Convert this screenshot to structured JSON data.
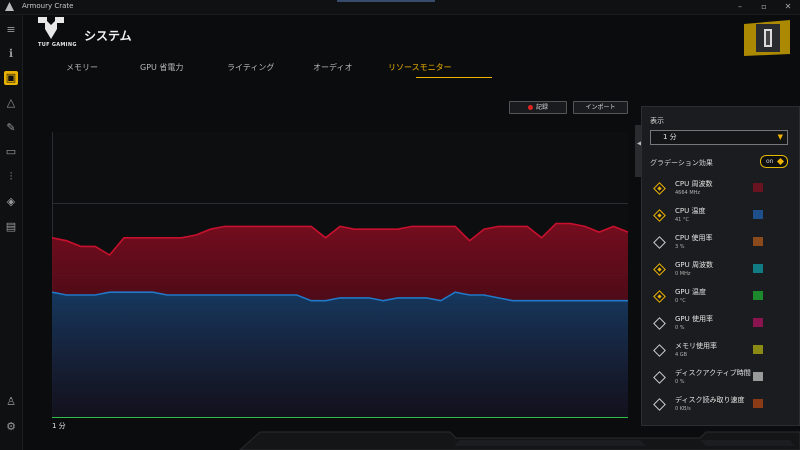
{
  "window": {
    "title": "Armoury Crate"
  },
  "header": {
    "page_title": "システム",
    "logo_text": "TUF GAMING"
  },
  "tabs": [
    {
      "label": "メモリー",
      "active": false
    },
    {
      "label": "GPU 省電力",
      "active": false
    },
    {
      "label": "ライティング",
      "active": false
    },
    {
      "label": "オーディオ",
      "active": false
    },
    {
      "label": "リソースモニター",
      "active": true
    }
  ],
  "toolbar": {
    "record_label": "記録",
    "import_label": "インポート"
  },
  "chart_data": {
    "type": "area",
    "xlabel": "1 分",
    "series": [
      {
        "name": "CPU 周波数",
        "color": "#c8102e",
        "values": [
          63,
          62,
          60,
          60,
          57,
          63,
          63,
          63,
          63,
          63,
          64,
          66,
          67,
          67,
          67,
          67,
          67,
          67,
          67,
          63,
          67,
          66,
          66,
          66,
          66,
          67,
          67,
          67,
          67,
          62,
          66,
          67,
          67,
          67,
          63,
          68,
          68,
          67,
          65,
          67,
          65
        ]
      },
      {
        "name": "CPU 温度",
        "color": "#1f78c8",
        "values": [
          44,
          43,
          43,
          43,
          44,
          44,
          44,
          44,
          43,
          43,
          43,
          43,
          43,
          43,
          43,
          43,
          43,
          43,
          41,
          41,
          42,
          42,
          42,
          41,
          42,
          42,
          42,
          41,
          44,
          43,
          43,
          42,
          41,
          41,
          41,
          41,
          41,
          41,
          41,
          41,
          41
        ]
      },
      {
        "name": "GPU 温度",
        "color": "#2fbf4a",
        "values": [
          0,
          0,
          0,
          0,
          0,
          0,
          0,
          0,
          0,
          0,
          0,
          0,
          0,
          0,
          0,
          0,
          0,
          0,
          0,
          0,
          0,
          0,
          0,
          0,
          0,
          0,
          0,
          0,
          0,
          0,
          0,
          0,
          0,
          0,
          0,
          0,
          0,
          0,
          0,
          0,
          0
        ]
      }
    ],
    "ylim": [
      0,
      100
    ]
  },
  "panel": {
    "display_label": "表示",
    "display_value": "1 分",
    "gradient_label": "グラデーション効果",
    "gradient_toggle": "on",
    "metrics": [
      {
        "name": "CPU 周波数",
        "value": "4664 MHz",
        "checked": true,
        "color": "#6a1320"
      },
      {
        "name": "CPU 温度",
        "value": "41 °C",
        "checked": true,
        "color": "#1f4f8a"
      },
      {
        "name": "CPU 使用率",
        "value": "3 %",
        "checked": false,
        "color": "#8a4a1c"
      },
      {
        "name": "GPU 周波数",
        "value": "0 MHz",
        "checked": true,
        "color": "#127c84"
      },
      {
        "name": "GPU 温度",
        "value": "0 °C",
        "checked": true,
        "color": "#1c8a2c"
      },
      {
        "name": "GPU 使用率",
        "value": "0 %",
        "checked": false,
        "color": "#8a1450"
      },
      {
        "name": "メモリ使用率",
        "value": "4 GB",
        "checked": false,
        "color": "#8a8a14"
      },
      {
        "name": "ディスクアクティブ時間",
        "value": "0 %",
        "checked": false,
        "color": "#9a9a9a"
      },
      {
        "name": "ディスク読み取り速度",
        "value": "0 KB/s",
        "checked": false,
        "color": "#8a3a14"
      }
    ]
  }
}
